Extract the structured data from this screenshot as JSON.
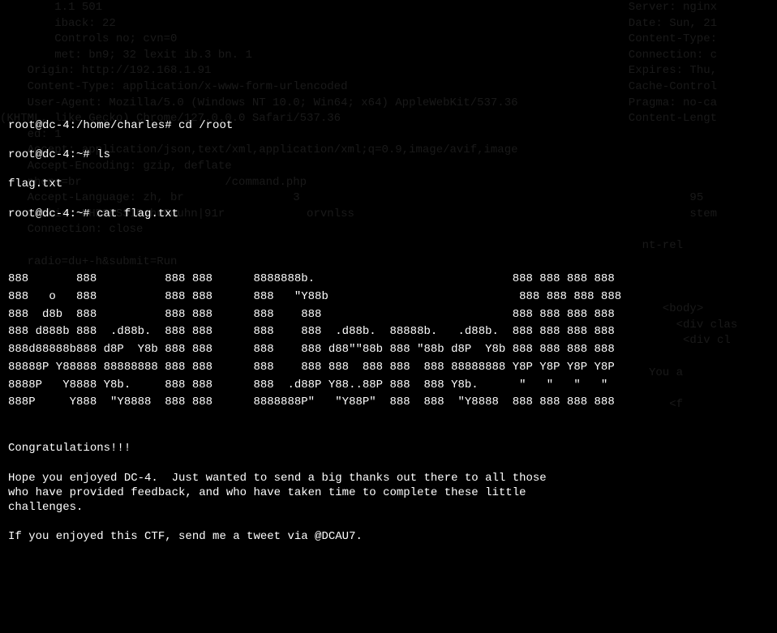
{
  "terminal": {
    "lines": [
      {
        "prompt": "root@dc-4:/home/charles#",
        "cmd": " cd /root"
      },
      {
        "prompt": "root@dc-4:~#",
        "cmd": " ls"
      },
      {
        "output": "flag.txt"
      },
      {
        "prompt": "root@dc-4:~#",
        "cmd": " cat flag.txt"
      }
    ],
    "ascii": [
      "",
      "",
      "888       888          888 888      8888888b.                             888 888 888 888",
      "888   o   888          888 888      888   \"Y88b                            888 888 888 888",
      "888  d8b  888          888 888      888    888                            888 888 888 888",
      "888 d888b 888  .d88b.  888 888      888    888  .d88b.  88888b.   .d88b.  888 888 888 888",
      "888d88888b888 d8P  Y8b 888 888      888    888 d88\"\"88b 888 \"88b d8P  Y8b 888 888 888 888",
      "88888P Y88888 88888888 888 888      888    888 888  888 888  888 88888888 Y8P Y8P Y8P Y8P",
      "8888P   Y8888 Y8b.     888 888      888  .d88P Y88..88P 888  888 Y8b.      \"   \"   \"   \" ",
      "888P     Y888  \"Y8888  888 888      8888888P\"   \"Y88P\"  888  888  \"Y8888  888 888 888 888",
      ""
    ],
    "congrats": [
      "",
      "Congratulations!!!",
      "",
      "Hope you enjoyed DC-4.  Just wanted to send a big thanks out there to all those",
      "who have provided feedback, and who have taken time to complete these little",
      "challenges.",
      "",
      "If you enjoyed this CTF, send me a tweet via @DCAU7."
    ]
  },
  "background_left": [
    "        1.1 501",
    "        iback: 22",
    "        Controls no; cvn=0",
    "        met: bn9; 32 lexit ib.3 bn. 1",
    "    Origin: http://192.168.1.91",
    "    Content-Type: application/x-www-form-urlencoded",
    "    User-Agent: Mozilla/5.0 (Windows NT 10.0; Win64; x64) AppleWebKit/537.36",
    "(KHTML, like Gecko) Chrome/127.0.0.0 Safari/537.36",
    "    ed: 1",
    "    Accept: application/json,text/xml,application/xml;q=0.9,image/avif,image",
    "    Accept-Encoding: gzip, deflate",
    "    phone=br                     /command.php",
    "    Accept-Language: zh, br                3",
    "    Cookie: PHPSESSID=huRouhn|91r            orvnlss",
    "    Connection: close",
    "",
    "    radio=du+-h&submit=Run",
    ""
  ],
  "background_right": [
    "  Server: nginx",
    "  Date: Sun, 21",
    "  Content-Type:",
    "  Connection: c",
    "  Expires: Thu,",
    "  Cache-Control",
    "  Pragma: no-ca",
    "  Content-Lengt",
    "",
    "",
    "",
    "",
    "           95",
    "           stem",
    "",
    "    nt-rel",
    "",
    "",
    "",
    "       <body>",
    "         <div clas",
    "          <div cl",
    "",
    "     You a",
    "",
    "        <f",
    ""
  ]
}
